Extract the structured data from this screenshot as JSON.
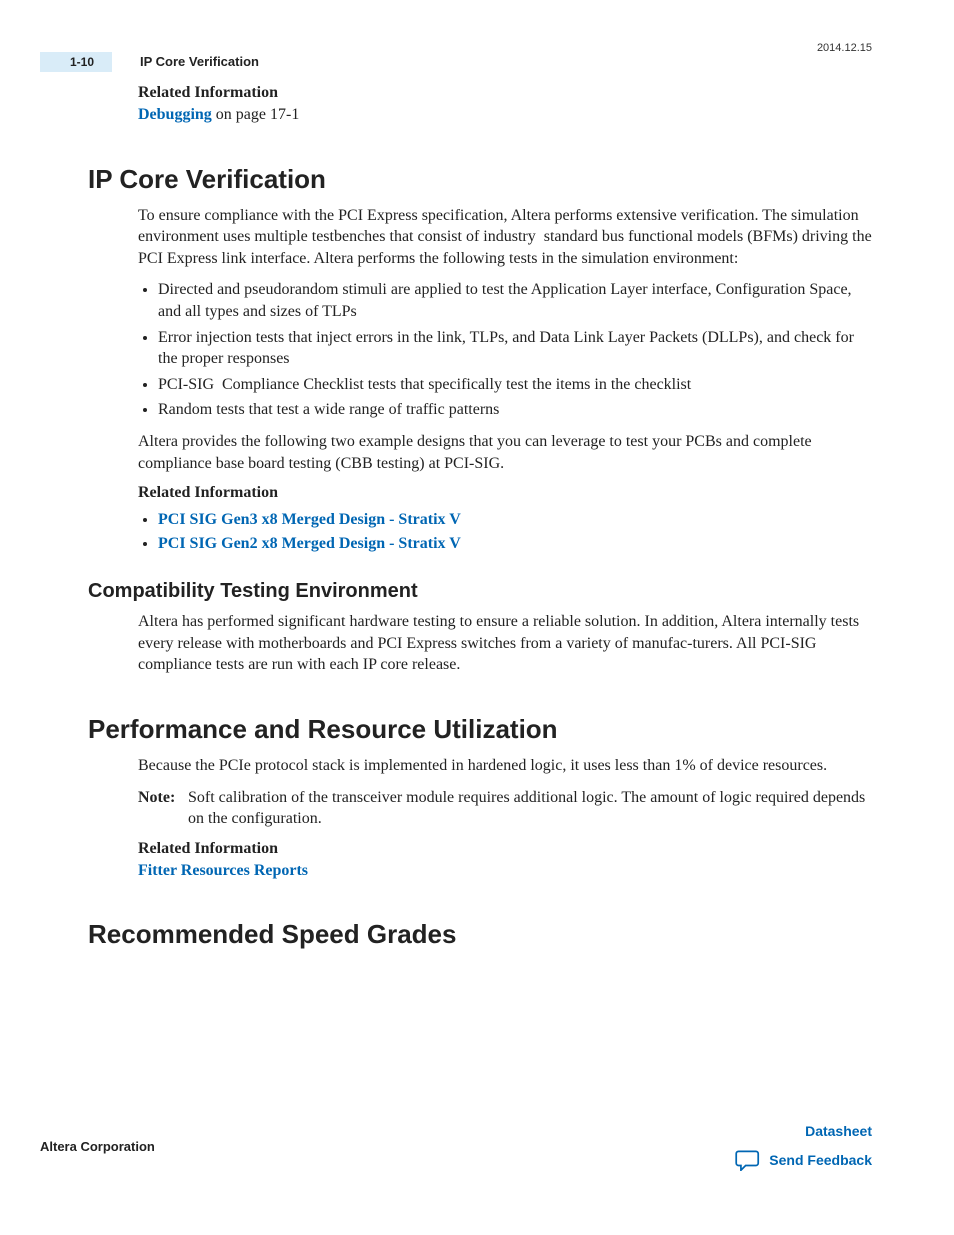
{
  "header": {
    "page_number": "1-10",
    "running_title": "IP Core Verification",
    "date": "2014.12.15"
  },
  "top_related": {
    "label": "Related Information",
    "link_text": "Debugging",
    "suffix": " on page 17-1"
  },
  "section1": {
    "title": "IP Core Verification",
    "para1": "To ensure compliance with the PCI Express specification, Altera performs extensive verification. The simulation environment uses multiple testbenches that consist of industry  standard bus functional models (BFMs) driving the PCI Express link interface. Altera performs the following tests in the simulation environment:",
    "bullets": [
      "Directed and pseudorandom stimuli are applied to test the Application Layer interface, Configuration Space, and all types and sizes of TLPs",
      "Error injection tests that inject errors in the link, TLPs, and Data Link Layer Packets (DLLPs), and check for the proper responses",
      "PCI-SIG   Compliance Checklist tests that specifically test the items in the checklist",
      "Random tests that test a wide range of traffic patterns"
    ],
    "para2": "Altera provides the following two example designs that you can leverage to test your PCBs and complete compliance base board testing (CBB testing) at PCI-SIG.",
    "related_label": "Related Information",
    "links": [
      "PCI SIG Gen3 x8 Merged Design - Stratix V",
      "PCI SIG Gen2 x8 Merged Design - Stratix V"
    ]
  },
  "section1_sub": {
    "title": "Compatibility Testing Environment",
    "para": "Altera has performed significant hardware testing to ensure a reliable solution. In addition, Altera internally tests every release with motherboards and PCI Express switches from a variety of manufac‐turers. All PCI-SIG compliance tests are run with each IP core release."
  },
  "section2": {
    "title": "Performance and Resource Utilization",
    "para": "Because the PCIe protocol stack is implemented in hardened logic, it uses less than 1% of device resources.",
    "note_label": "Note:",
    "note_text": "Soft calibration of the transceiver module requires additional logic. The amount of logic required depends on the configuration.",
    "related_label": "Related Information",
    "link": "Fitter Resources Reports"
  },
  "section3": {
    "title": "Recommended Speed Grades"
  },
  "footer": {
    "left": "Altera Corporation",
    "datasheet": "Datasheet",
    "feedback": "Send Feedback"
  }
}
